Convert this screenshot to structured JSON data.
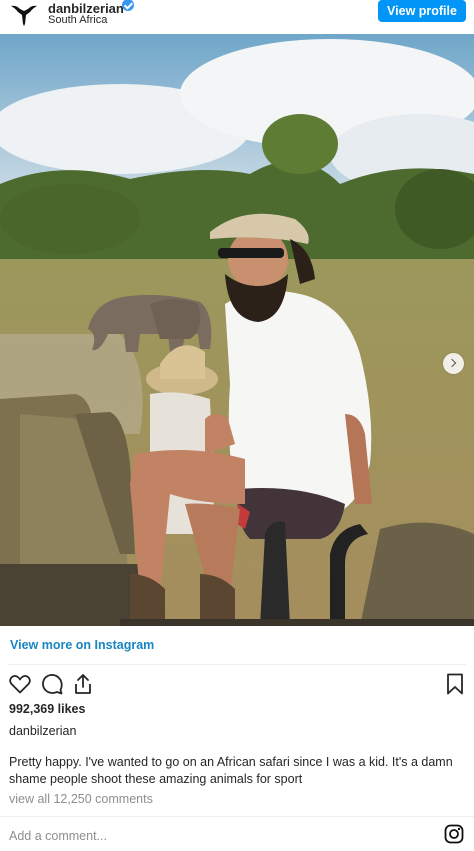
{
  "header": {
    "username": "danbilzerian",
    "location": "South Africa",
    "view_profile": "View profile",
    "verified_icon": "verified-badge-icon",
    "avatar_icon": "ram-skull-logo"
  },
  "carousel": {
    "slide_count": 6,
    "active_slide": 1
  },
  "view_more": "View more on Instagram",
  "actions": {
    "like_icon": "heart-icon",
    "comment_icon": "comment-icon",
    "share_icon": "share-icon",
    "save_icon": "bookmark-icon"
  },
  "likes": "992,369 likes",
  "caption": {
    "username": "danbilzerian",
    "text": "Pretty happy. I've wanted to go on an African safari since I was a kid. It's a damn shame people shoot these amazing animals for sport"
  },
  "comments_link": "view all 12,250 comments",
  "add_comment_placeholder": "Add a comment...",
  "colors": {
    "accent": "#0095f6",
    "link": "#1985c4",
    "muted": "#8e8e8e"
  }
}
